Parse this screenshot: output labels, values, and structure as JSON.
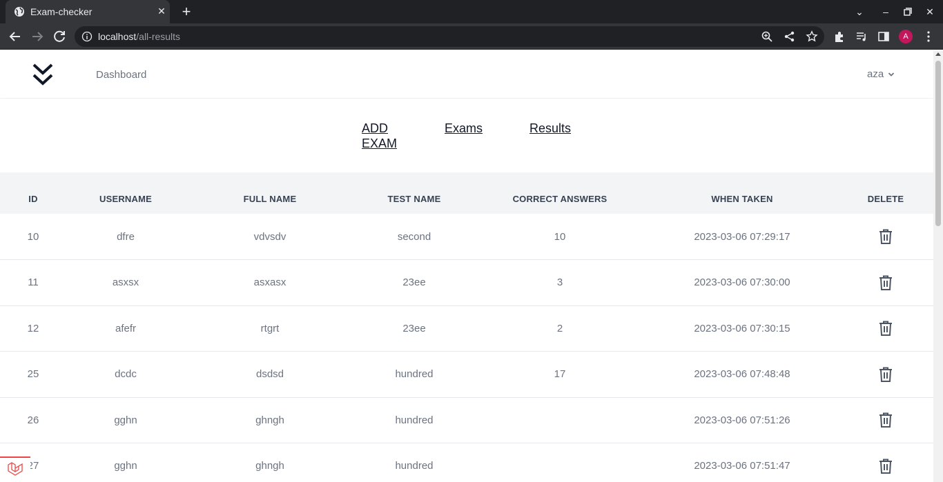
{
  "browser": {
    "tab_title": "Exam-checker",
    "url_host": "localhost",
    "url_path": "/all-results",
    "avatar_letter": "A"
  },
  "nav": {
    "dashboard_label": "Dashboard",
    "user_name": "aza"
  },
  "header": {
    "add_exam_line1": "ADD",
    "add_exam_line2": "EXAM",
    "exams_label": "Exams",
    "results_label": "Results"
  },
  "table": {
    "columns": [
      "ID",
      "USERNAME",
      "FULL NAME",
      "TEST NAME",
      "CORRECT ANSWERS",
      "WHEN TAKEN",
      "DELETE"
    ],
    "rows": [
      {
        "id": "10",
        "username": "dfre",
        "full_name": "vdvsdv",
        "test_name": "second",
        "correct": "10",
        "when": "2023-03-06 07:29:17"
      },
      {
        "id": "11",
        "username": "asxsx",
        "full_name": "asxasx",
        "test_name": "23ee",
        "correct": "3",
        "when": "2023-03-06 07:30:00"
      },
      {
        "id": "12",
        "username": "afefr",
        "full_name": "rtgrt",
        "test_name": "23ee",
        "correct": "2",
        "when": "2023-03-06 07:30:15"
      },
      {
        "id": "25",
        "username": "dcdc",
        "full_name": "dsdsd",
        "test_name": "hundred",
        "correct": "17",
        "when": "2023-03-06 07:48:48"
      },
      {
        "id": "26",
        "username": "gghn",
        "full_name": "ghngh",
        "test_name": "hundred",
        "correct": "",
        "when": "2023-03-06 07:51:26"
      },
      {
        "id": "27",
        "username": "gghn",
        "full_name": "ghngh",
        "test_name": "hundred",
        "correct": "",
        "when": "2023-03-06 07:51:47"
      }
    ]
  },
  "colors": {
    "chrome_dark": "#202124",
    "chrome_toolbar": "#35363a",
    "page_bg": "#f3f4f6",
    "text_muted": "#6b7280",
    "laravel_red": "#ef4444"
  }
}
